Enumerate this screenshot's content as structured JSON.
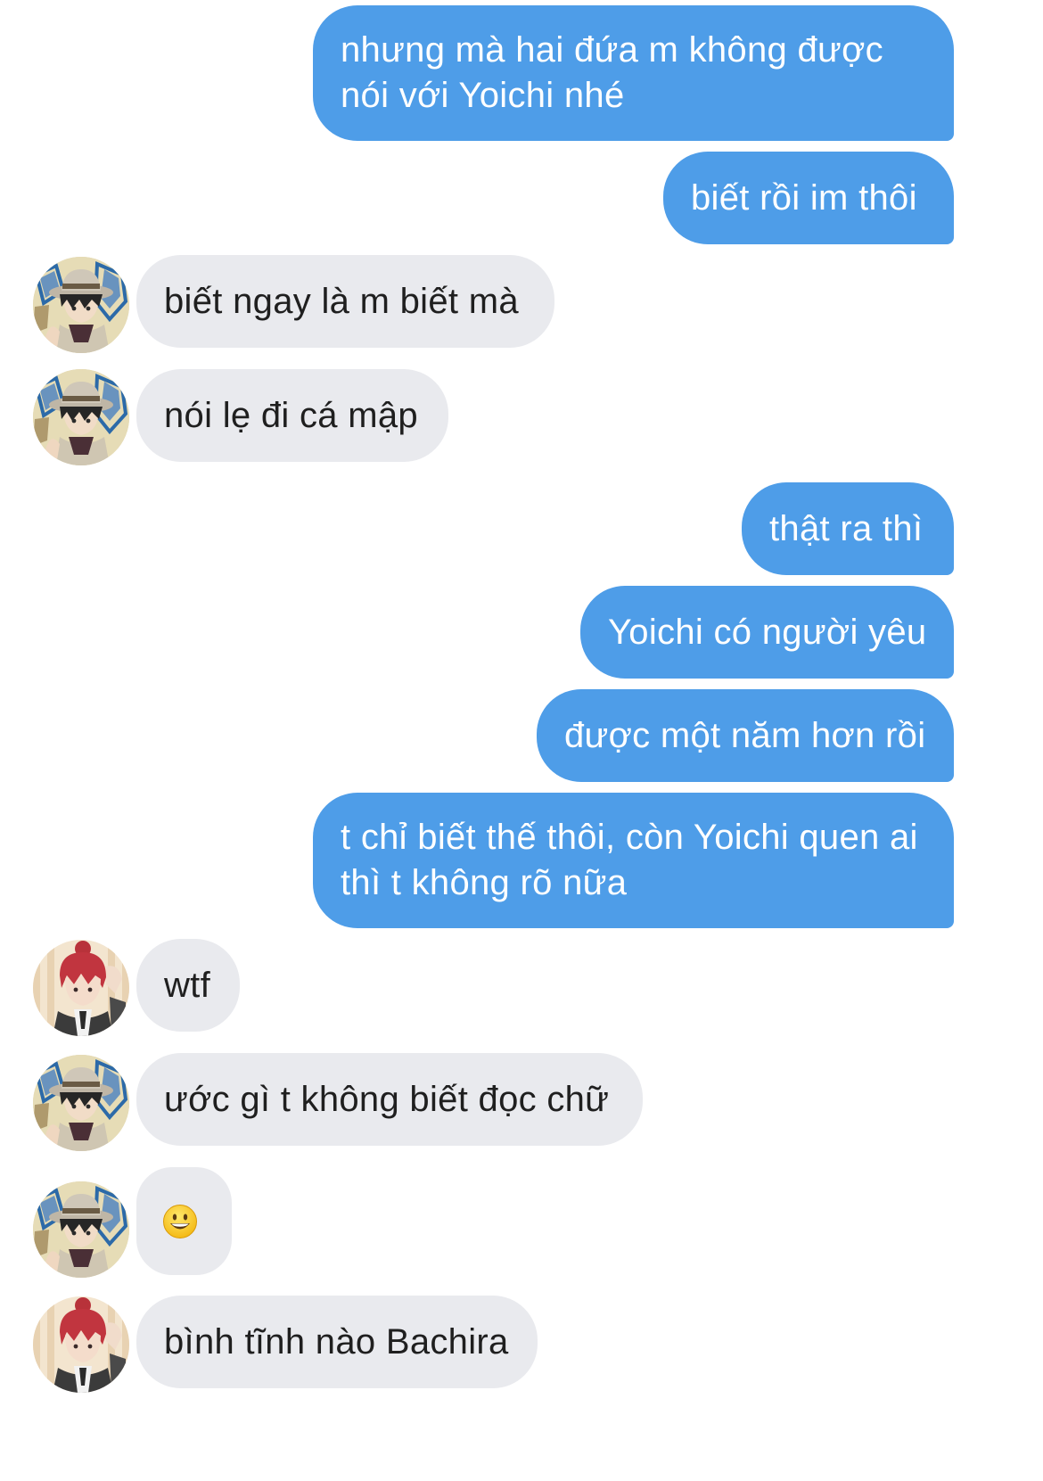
{
  "messages": [
    {
      "side": "out",
      "text": "nhưng mà hai đứa m không được nói với Yoichi nhé"
    },
    {
      "side": "out",
      "text": "biết rồi im thôi"
    },
    {
      "side": "in",
      "avatar": "hat-avatar",
      "text": "biết ngay là m biết mà"
    },
    {
      "side": "in",
      "avatar": "hat-avatar",
      "text": "nói lẹ đi cá mập"
    },
    {
      "side": "out",
      "text": "thật ra thì"
    },
    {
      "side": "out",
      "text": "Yoichi có người yêu"
    },
    {
      "side": "out",
      "text": "được một năm hơn rồi"
    },
    {
      "side": "out",
      "text": "t chỉ biết thế thôi, còn Yoichi quen ai thì t không rõ nữa"
    },
    {
      "side": "in",
      "avatar": "red-hair-avatar",
      "text": "wtf"
    },
    {
      "side": "in",
      "avatar": "hat-avatar",
      "text": "ước gì t không biết đọc chữ"
    },
    {
      "side": "in",
      "avatar": "hat-avatar",
      "emoji": "grinning-face-emoji"
    },
    {
      "side": "in",
      "avatar": "red-hair-avatar",
      "text": "bình tĩnh nào Bachira"
    }
  ],
  "colors": {
    "outgoing_bubble": "#4e9de8",
    "incoming_bubble": "#e9eaee",
    "outgoing_text": "#ffffff",
    "incoming_text": "#1f1f1f"
  }
}
